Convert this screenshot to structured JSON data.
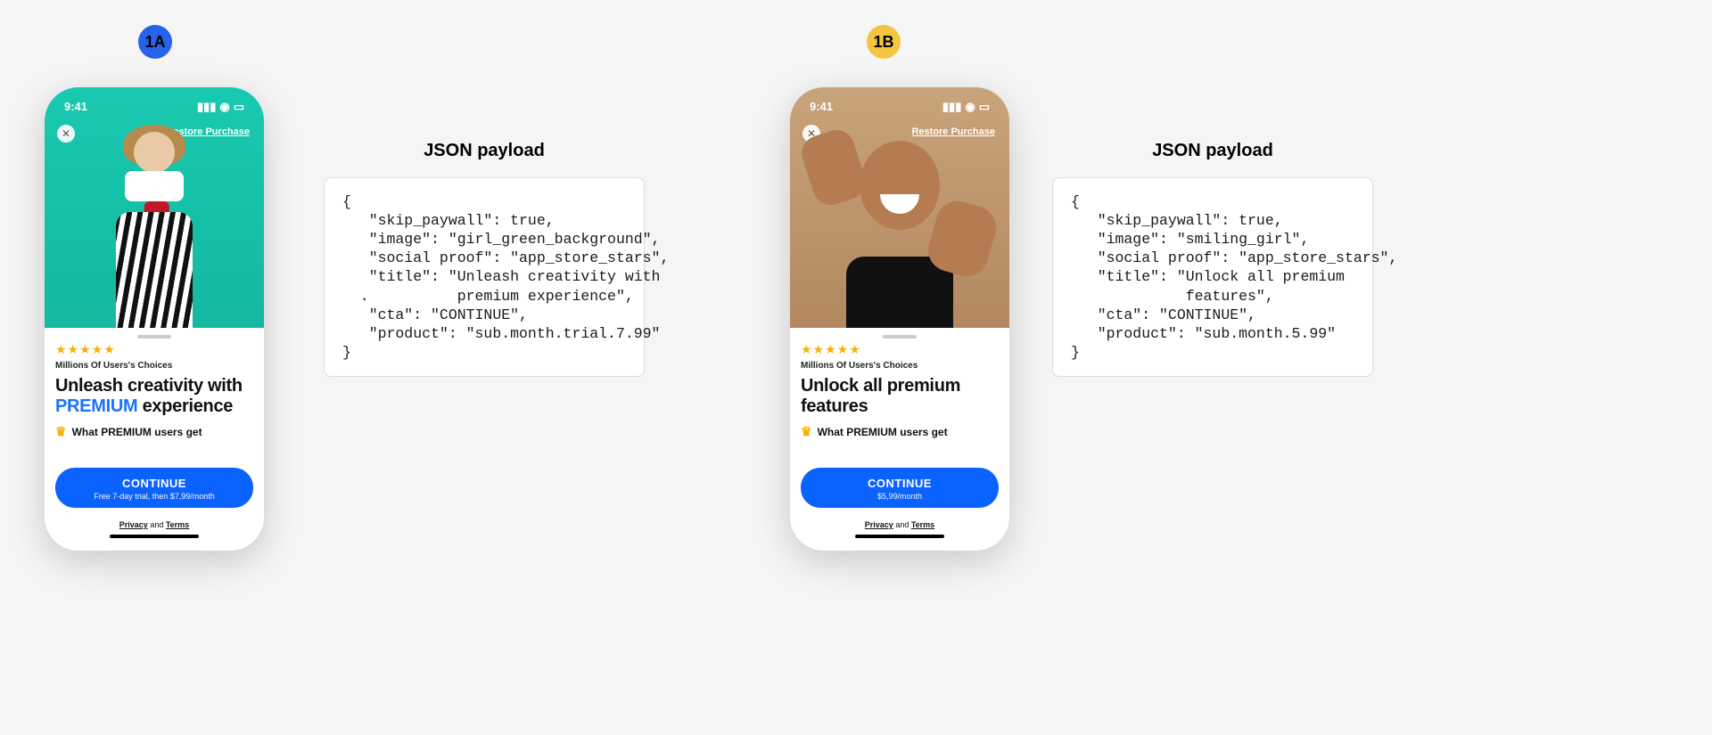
{
  "variant_a": {
    "badge": "1A",
    "status_time": "9:41",
    "close_glyph": "✕",
    "restore": "Restore Purchase",
    "stars_glyph": "★★★★★",
    "microcopy": "Millions Of Users's Choices",
    "title_pre": "Unleash creativity with ",
    "title_premium": "PREMIUM",
    "title_post": " experience",
    "crown_glyph": "♛",
    "subline": "What PREMIUM users get",
    "cta_label": "CONTINUE",
    "cta_sub": "Free 7-day trial, then $7,99/month",
    "privacy": "Privacy",
    "and": " and ",
    "terms": "Terms",
    "json_heading": "JSON payload",
    "json_text": "{\n   \"skip_paywall\": true,\n   \"image\": \"girl_green_background\",\n   \"social proof\": \"app_store_stars\",\n   \"title\": \"Unleash creativity with\n  .          premium experience\",\n   \"cta\": \"CONTINUE\",\n   \"product\": \"sub.month.trial.7.99\"\n}"
  },
  "variant_b": {
    "badge": "1B",
    "status_time": "9:41",
    "close_glyph": "✕",
    "restore": "Restore Purchase",
    "stars_glyph": "★★★★★",
    "microcopy": "Millions Of Users's Choices",
    "title": "Unlock all premium features",
    "crown_glyph": "♛",
    "subline": "What PREMIUM users get",
    "cta_label": "CONTINUE",
    "cta_sub": "$5,99/month",
    "privacy": "Privacy",
    "and": " and ",
    "terms": "Terms",
    "json_heading": "JSON payload",
    "json_text": "{\n   \"skip_paywall\": true,\n   \"image\": \"smiling_girl\",\n   \"social proof\": \"app_store_stars\",\n   \"title\": \"Unlock all premium\n             features\",\n   \"cta\": \"CONTINUE\",\n   \"product\": \"sub.month.5.99\"\n}"
  }
}
